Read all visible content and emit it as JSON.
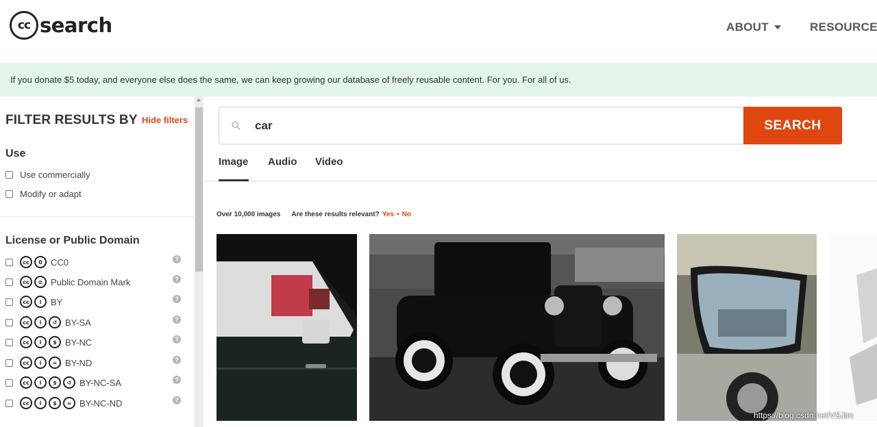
{
  "header": {
    "logo_text": "search",
    "logo_cc": "cc",
    "nav": [
      {
        "label": "ABOUT"
      },
      {
        "label": "RESOURCES"
      }
    ]
  },
  "banner": {
    "text": "If you donate $5 today, and everyone else does the same, we can keep growing our database of freely reusable content. For you. For all of us."
  },
  "sidebar": {
    "title": "FILTER RESULTS BY",
    "hide_filters": "Hide filters",
    "use": {
      "title": "Use",
      "options": [
        {
          "label": "Use commercially",
          "checked": false
        },
        {
          "label": "Modify or adapt",
          "checked": false
        }
      ]
    },
    "license": {
      "title": "License or Public Domain",
      "options": [
        {
          "label": "CC0",
          "icons": [
            "cc",
            "zero"
          ]
        },
        {
          "label": "Public Domain Mark",
          "icons": [
            "cc",
            "pd"
          ]
        },
        {
          "label": "BY",
          "icons": [
            "cc",
            "by"
          ]
        },
        {
          "label": "BY-SA",
          "icons": [
            "cc",
            "by",
            "sa"
          ]
        },
        {
          "label": "BY-NC",
          "icons": [
            "cc",
            "by",
            "nc"
          ]
        },
        {
          "label": "BY-ND",
          "icons": [
            "cc",
            "by",
            "nd"
          ]
        },
        {
          "label": "BY-NC-SA",
          "icons": [
            "cc",
            "by",
            "nc",
            "sa"
          ]
        },
        {
          "label": "BY-NC-ND",
          "icons": [
            "cc",
            "by",
            "nc",
            "nd"
          ]
        }
      ]
    }
  },
  "search": {
    "value": "car",
    "button": "SEARCH"
  },
  "tabs": [
    {
      "label": "Image",
      "active": true
    },
    {
      "label": "Audio",
      "active": false
    },
    {
      "label": "Video",
      "active": false
    }
  ],
  "results": {
    "count": "Over 10,000 images",
    "relevance_q": "Are these results relevant?",
    "yes": "Yes",
    "dot": "•",
    "no": "No"
  },
  "watermark": "https://blog.csdn.net/VSJim",
  "colors": {
    "accent": "#e0460f",
    "banner_bg": "#e3f4ea"
  }
}
